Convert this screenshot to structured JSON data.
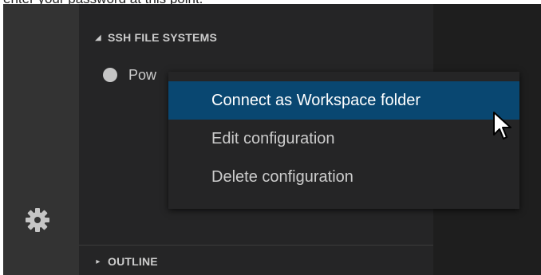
{
  "caption": "enter your password at this point.",
  "sidebar": {
    "ssh_section": {
      "title": "SSH FILE SYSTEMS",
      "items": [
        {
          "label": "Pow"
        }
      ]
    },
    "outline_section": {
      "title": "OUTLINE"
    }
  },
  "context_menu": {
    "items": [
      {
        "label": "Connect as Workspace folder"
      },
      {
        "label": "Edit configuration"
      },
      {
        "label": "Delete configuration"
      }
    ]
  },
  "icons": {
    "ssh_twisty": "chevron-down-icon",
    "outline_twisty": "chevron-right-icon",
    "status": "status-dot-icon",
    "settings": "gear-icon",
    "pointer": "cursor-icon"
  },
  "colors": {
    "background": "#1e1e1e",
    "activity_bar": "#333333",
    "sidebar": "#252526",
    "menu_highlight": "#094771",
    "text": "#cccccc"
  }
}
